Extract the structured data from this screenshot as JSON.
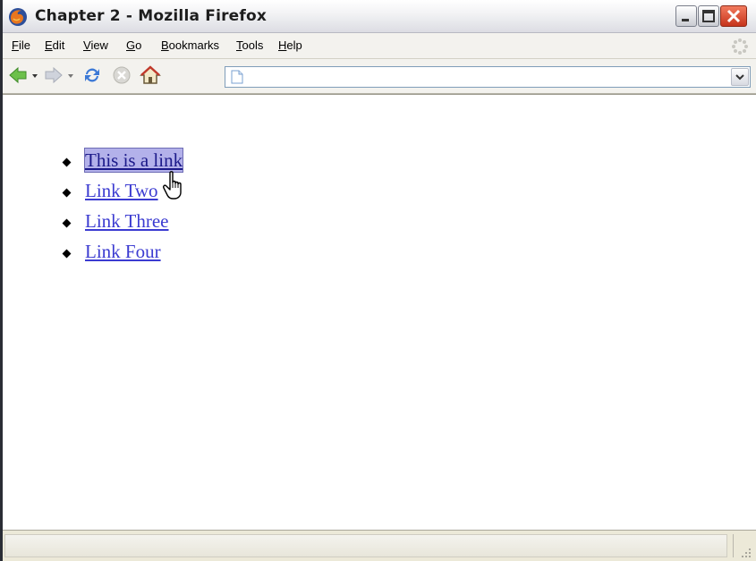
{
  "window": {
    "title": "Chapter 2 - Mozilla Firefox"
  },
  "menu": {
    "items": [
      {
        "label": "File",
        "accesskey": "F",
        "rest": "ile"
      },
      {
        "label": "Edit",
        "accesskey": "E",
        "rest": "dit"
      },
      {
        "label": "View",
        "accesskey": "V",
        "rest": "iew"
      },
      {
        "label": "Go",
        "accesskey": "G",
        "rest": "o"
      },
      {
        "label": "Bookmarks",
        "accesskey": "B",
        "rest": "ookmarks"
      },
      {
        "label": "Tools",
        "accesskey": "T",
        "rest": "ools"
      },
      {
        "label": "Help",
        "accesskey": "H",
        "rest": "elp"
      }
    ]
  },
  "toolbar": {
    "url_value": "",
    "icons": [
      "back-icon",
      "forward-icon",
      "reload-icon",
      "stop-icon",
      "home-icon"
    ]
  },
  "content": {
    "links": [
      {
        "text": "This is a link",
        "hovered": true
      },
      {
        "text": "Link Two",
        "hovered": false
      },
      {
        "text": "Link Three",
        "hovered": false
      },
      {
        "text": "Link Four",
        "hovered": false
      }
    ]
  },
  "status": {
    "text": ""
  },
  "colors": {
    "link": "#3b3bd1",
    "link_hover_bg": "#b3b1ea",
    "close_button": "#c6341c"
  }
}
